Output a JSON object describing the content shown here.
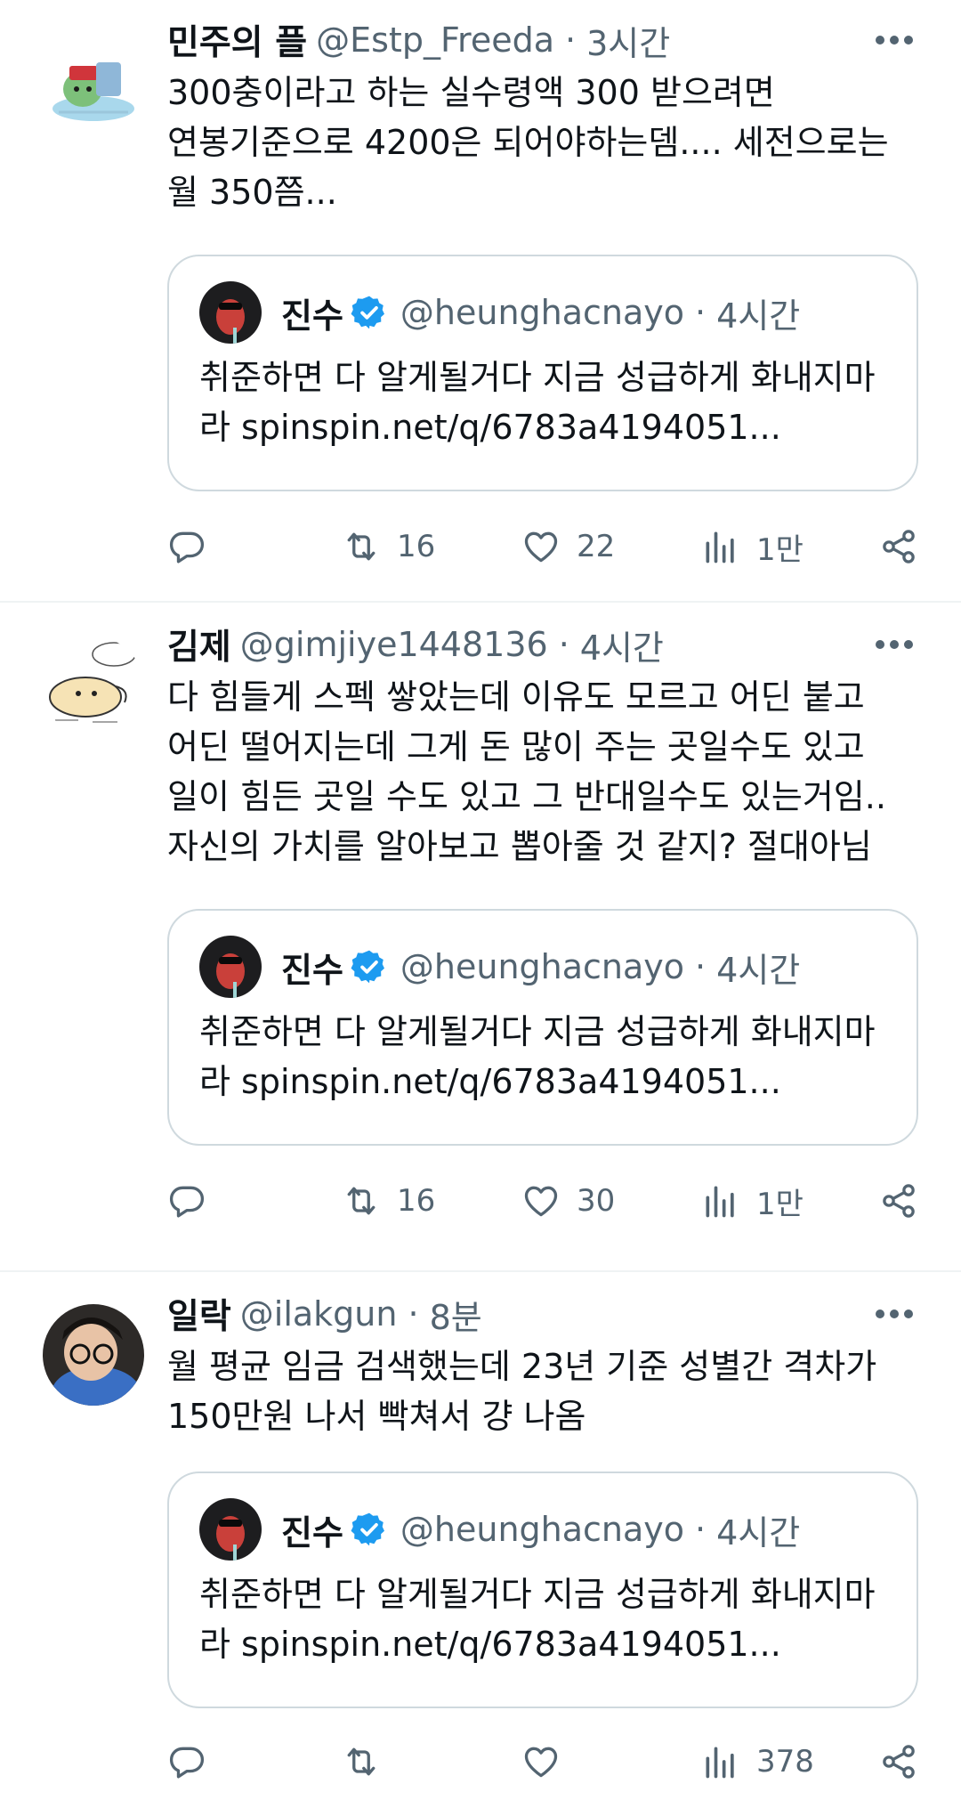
{
  "tweets": [
    {
      "name": "민주의 플",
      "handle": "@Estp_Freeda",
      "dot": "·",
      "time": "3시간",
      "text": "300충이라고 하는 실수령액 300 받으려면 연봉기준으로 4200은 되어야하는뎀.... 세전으로는 월 350쯤...",
      "quote": {
        "name": "진수",
        "handle": "@heunghacnayo",
        "dot": "·",
        "time": "4시간",
        "text": "취준하면 다 알게될거다 지금 성급하게 화내지마라 spinspin.net/q/6783a4194051..."
      },
      "actions": {
        "replies": "",
        "retweets": "16",
        "likes": "22",
        "views": "1만"
      }
    },
    {
      "name": "김제",
      "handle": "@gimjiye1448136",
      "dot": "·",
      "time": "4시간",
      "text": "다 힘들게 스펙 쌓았는데 이유도 모르고 어딘 붙고 어딘 떨어지는데 그게 돈 많이 주는 곳일수도 있고 일이 힘든 곳일 수도 있고 그 반대일수도 있는거임.. 자신의 가치를 알아보고 뽑아줄 것 같지? 절대아님",
      "quote": {
        "name": "진수",
        "handle": "@heunghacnayo",
        "dot": "·",
        "time": "4시간",
        "text": "취준하면 다 알게될거다 지금 성급하게 화내지마라 spinspin.net/q/6783a4194051..."
      },
      "actions": {
        "replies": "",
        "retweets": "16",
        "likes": "30",
        "views": "1만"
      }
    },
    {
      "name": "일락",
      "handle": "@ilakgun",
      "dot": "·",
      "time": "8분",
      "text": "월 평균 임금 검색했는데 23년 기준 성별간 격차가 150만원 나서 빡쳐서 걍 나옴",
      "quote": {
        "name": "진수",
        "handle": "@heunghacnayo",
        "dot": "·",
        "time": "4시간",
        "text": "취준하면 다 알게될거다 지금 성급하게 화내지마라 spinspin.net/q/6783a4194051..."
      },
      "actions": {
        "replies": "",
        "retweets": "",
        "likes": "",
        "views": "378"
      }
    }
  ],
  "colors": {
    "text": "#0f1419",
    "secondary": "#536471",
    "border": "#cfd9de",
    "divider": "#eff3f4",
    "verified": "#1d9bf0"
  },
  "icons": [
    "reply-icon",
    "retweet-icon",
    "like-icon",
    "views-icon",
    "share-icon",
    "more-icon",
    "verified-icon"
  ]
}
